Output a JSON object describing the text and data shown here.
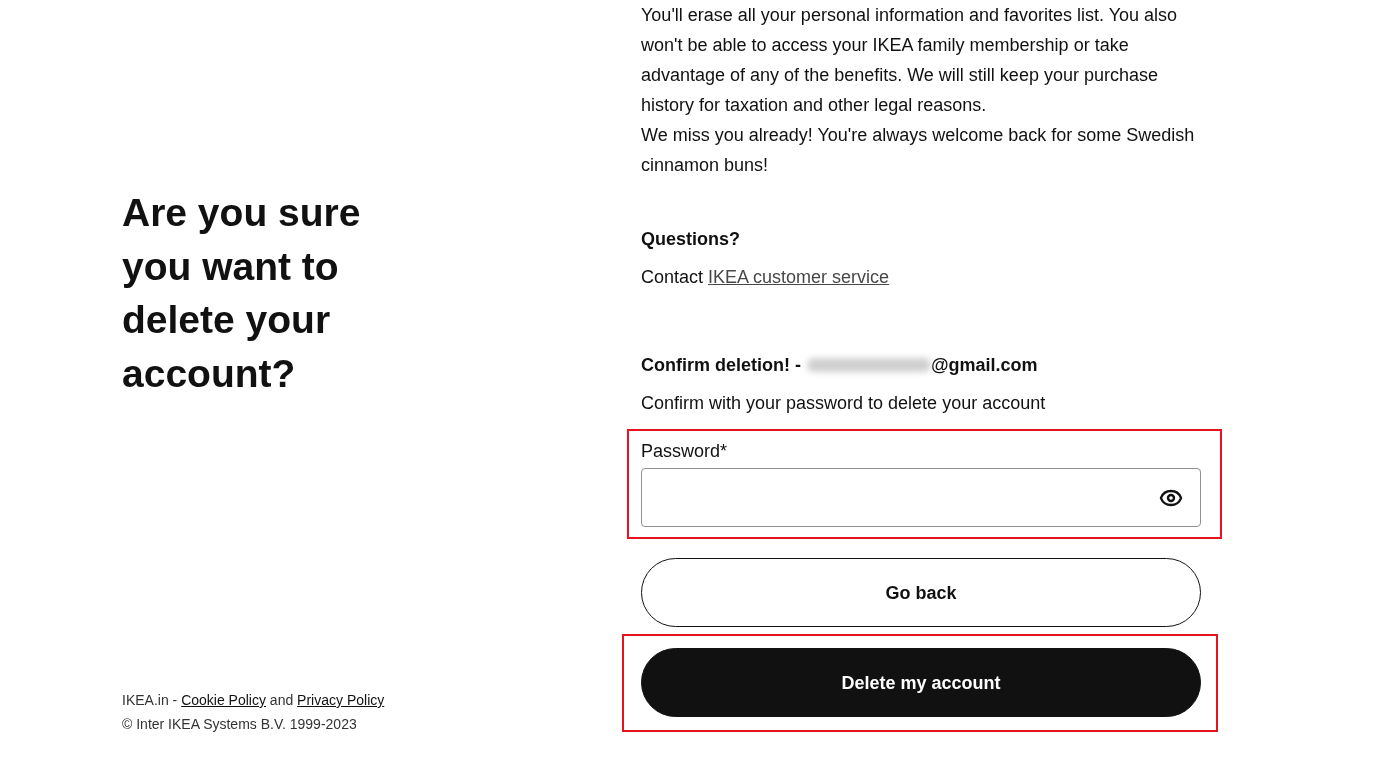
{
  "heading": "Are you sure you want to delete your account?",
  "message": {
    "paragraphs": [
      "You'll erase all your personal information and favorites list. You also won't be able to access your IKEA family membership or take advantage of any of the benefits. We will still keep your purchase history for taxation and other legal reasons.",
      "We miss you already! You're always welcome back for some Swedish cinnamon buns!"
    ]
  },
  "questions": {
    "title": "Questions?",
    "text": "Contact",
    "link": "IKEA customer service"
  },
  "confirm": {
    "title": "Confirm deletion! -",
    "email_redacted": true,
    "email_domain": "@gmail.com",
    "instruction": "Confirm with your password to delete your account"
  },
  "password_field": {
    "label": "Password*",
    "highlighted": true
  },
  "buttons": [
    {
      "label": "Go back",
      "kind": "secondary",
      "highlighted": false
    },
    {
      "label": "Delete my account",
      "kind": "primary",
      "highlighted": true
    }
  ],
  "footer": {
    "legal_line": [
      {
        "kind": "text",
        "text": "IKEA.in -"
      },
      {
        "kind": "link",
        "text": "Cookie Policy"
      },
      {
        "kind": "text",
        "text": "and"
      },
      {
        "kind": "link",
        "text": "Privacy Policy"
      }
    ],
    "copyright": "© Inter IKEA Systems B.V. 1999-2023"
  }
}
